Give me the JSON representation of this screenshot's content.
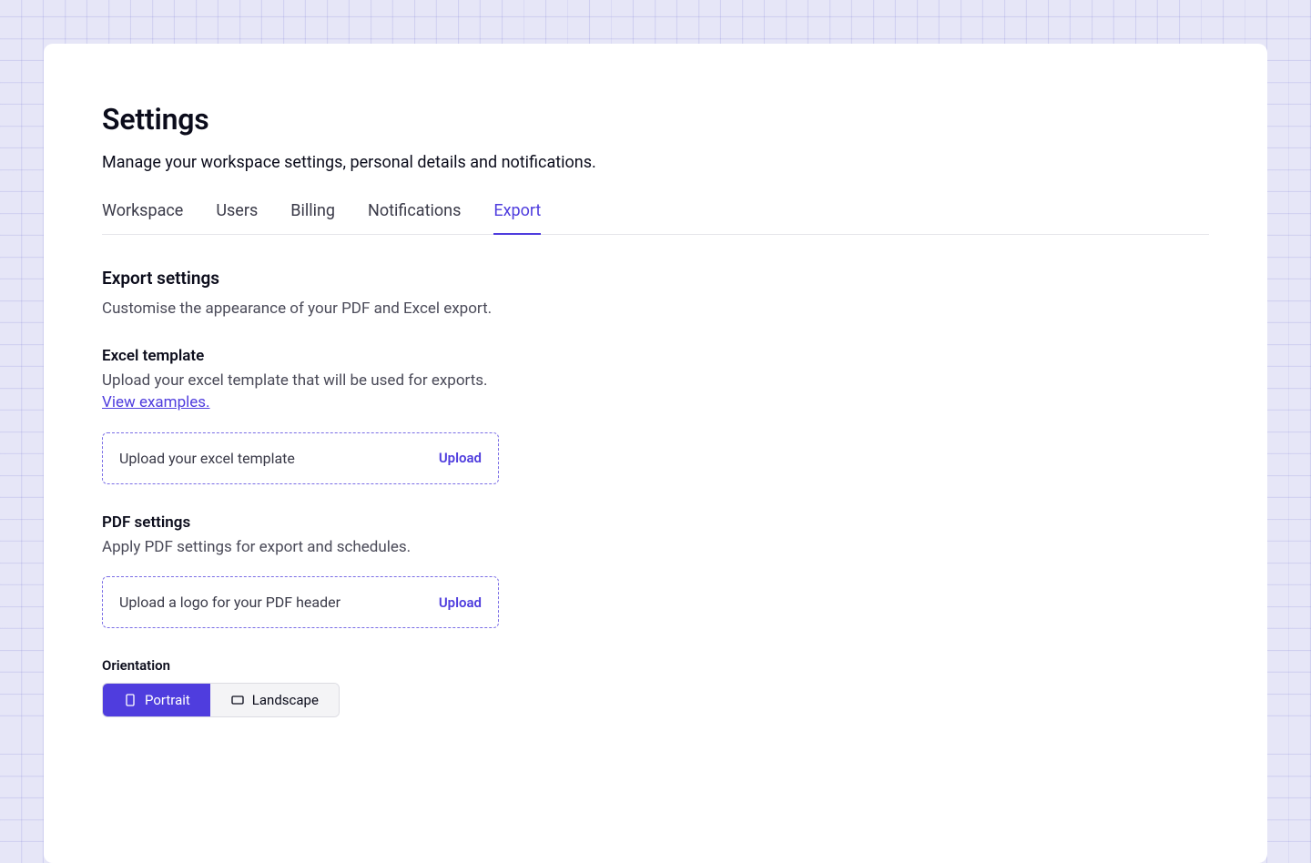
{
  "header": {
    "title": "Settings",
    "subtitle": "Manage your workspace settings, personal details and notifications."
  },
  "tabs": [
    {
      "label": "Workspace",
      "active": false
    },
    {
      "label": "Users",
      "active": false
    },
    {
      "label": "Billing",
      "active": false
    },
    {
      "label": "Notifications",
      "active": false
    },
    {
      "label": "Export",
      "active": true
    }
  ],
  "export": {
    "title": "Export settings",
    "desc": "Customise the appearance of your PDF and Excel export.",
    "excel": {
      "label": "Excel template",
      "help": "Upload your excel template that will be used for exports.",
      "examples_link": "View examples.",
      "upload_placeholder": "Upload your excel template",
      "upload_action": "Upload"
    },
    "pdf": {
      "label": "PDF settings",
      "help": "Apply PDF settings for export and schedules.",
      "upload_placeholder": "Upload a logo for your PDF header",
      "upload_action": "Upload",
      "orientation_label": "Orientation",
      "orientation_options": {
        "portrait": "Portrait",
        "landscape": "Landscape"
      },
      "orientation_selected": "portrait"
    }
  }
}
